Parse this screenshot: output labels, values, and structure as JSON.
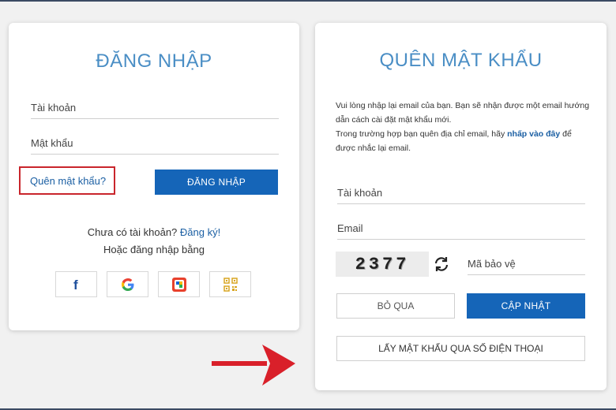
{
  "login": {
    "title": "ĐĂNG NHẬP",
    "account_placeholder": "Tài khoản",
    "password_placeholder": "Mật khẩu",
    "forgot_link": "Quên mật khẩu?",
    "login_button": "ĐĂNG NHẬP",
    "no_account_text": "Chưa có tài khoản?",
    "register_link": "Đăng ký!",
    "or_login_with": "Hoặc đăng nhập bằng",
    "social": [
      {
        "icon": "facebook-icon"
      },
      {
        "icon": "google-icon"
      },
      {
        "icon": "zalo-icon"
      },
      {
        "icon": "qr-code-icon"
      }
    ]
  },
  "forgot": {
    "title": "QUÊN MẬT KHẨU",
    "info_line1": "Vui lòng nhập lại email của bạn. Bạn sẽ nhận được một email hướng dẫn cách cài đặt mật khẩu mới.",
    "info_line2_prefix": "Trong trường hợp bạn quên địa chỉ email, hãy",
    "info_line2_link": "nhấp vào đây",
    "info_line2_suffix": "để được nhắc lại email.",
    "account_placeholder": "Tài khoản",
    "email_placeholder": "Email",
    "captcha_text": "2377",
    "security_code_placeholder": "Mã bảo vệ",
    "skip_button": "BỎ QUA",
    "update_button": "CẬP NHẬT",
    "phone_button": "LẤY MẬT KHẨU QUA SỐ ĐIỆN THOẠI"
  },
  "colors": {
    "primary": "#1565b8",
    "title": "#4a8ec5",
    "highlight": "#c9252c",
    "arrow": "#d9202a"
  }
}
